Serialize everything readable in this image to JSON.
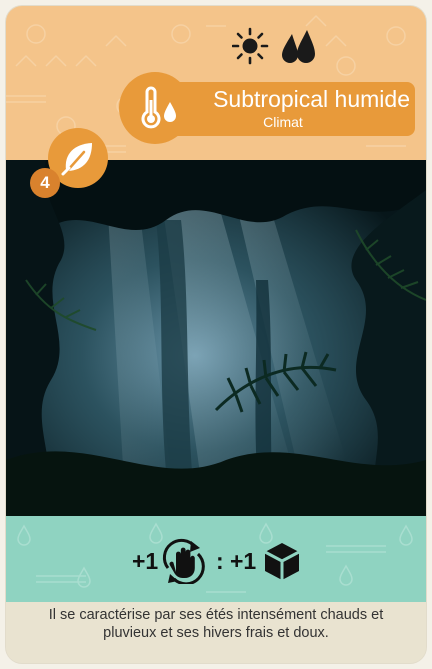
{
  "card": {
    "title": "Subtropical humide",
    "type": "Climat",
    "cost": "4",
    "cost_icon": "leaf-icon",
    "climate_icons": [
      "sun-icon",
      "water-drops-icon"
    ],
    "title_icon": "thermometer-drop-icon",
    "effect": {
      "gain_left": "+1",
      "action_icon": "hand-cycle-icon",
      "separator": ":",
      "gain_right": "+1",
      "resource_icon": "cube-icon"
    },
    "flavor_text": "Il se caractérise par ses étés intensément chauds et pluvieux et ses hivers frais et doux."
  },
  "colors": {
    "header_bg": "#f4c48a",
    "accent_orange": "#e89a3a",
    "effect_bg": "#8fd3c1",
    "text_bg": "#e9e3d0"
  }
}
